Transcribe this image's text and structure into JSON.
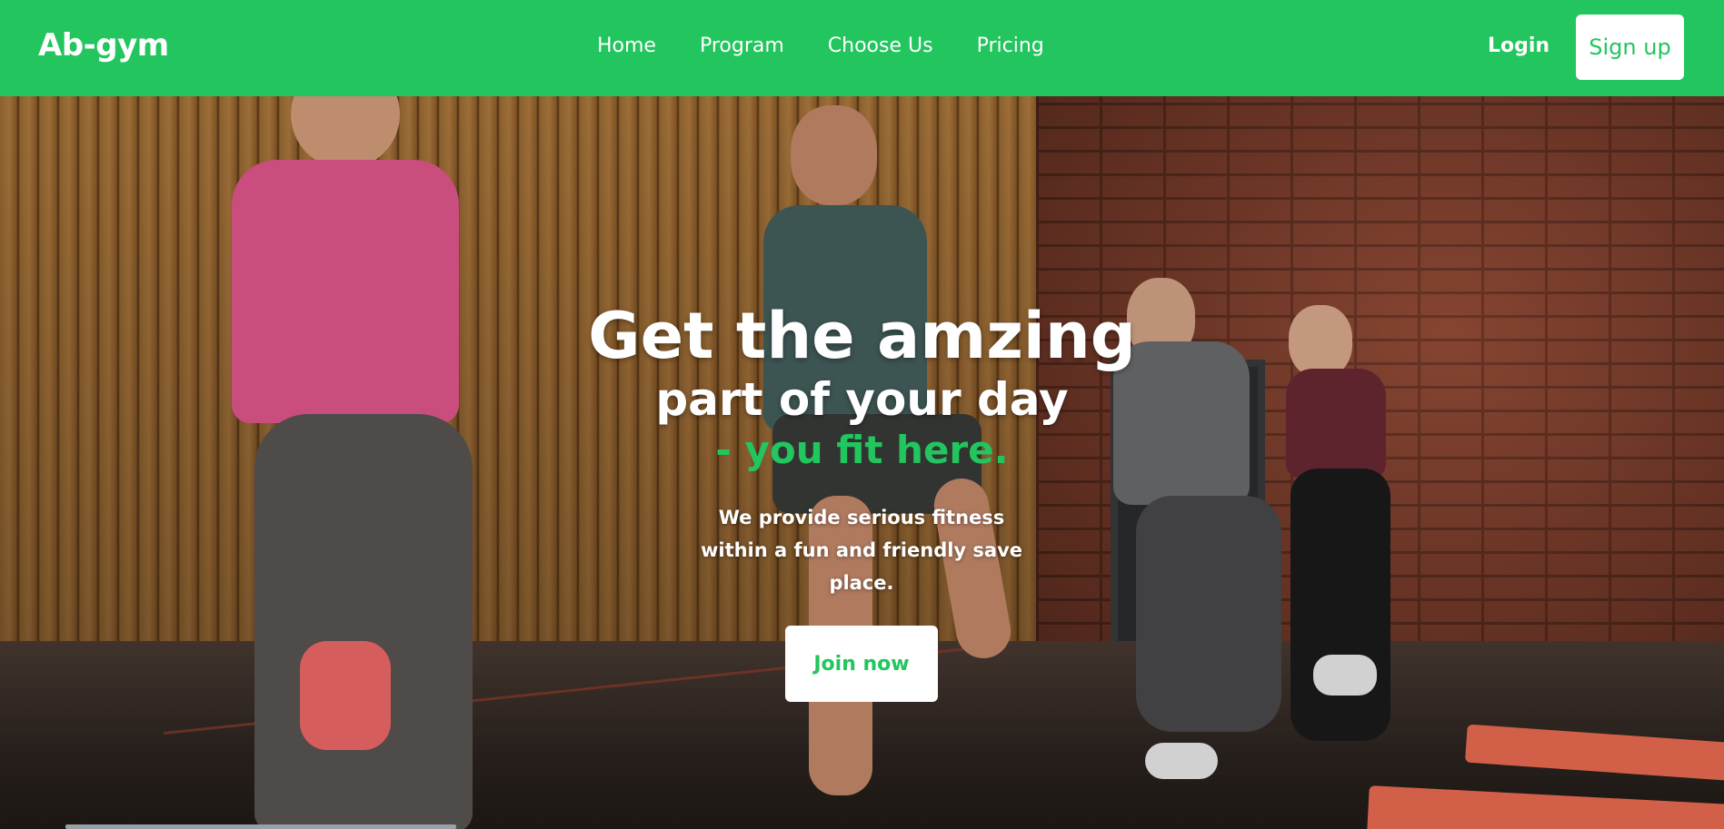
{
  "navbar": {
    "brand": "Ab-gym",
    "links": [
      "Home",
      "Program",
      "Choose Us",
      "Pricing"
    ],
    "login_label": "Login",
    "signup_label": "Sign up"
  },
  "hero": {
    "headline": "Get the amzing",
    "subheadline": "part of your day",
    "tagline": "- you fit here.",
    "description": "We provide serious fitness within a fun and friendly save place.",
    "cta_label": "Join now"
  },
  "colors": {
    "accent": "#22c55e",
    "text": "#ffffff"
  }
}
